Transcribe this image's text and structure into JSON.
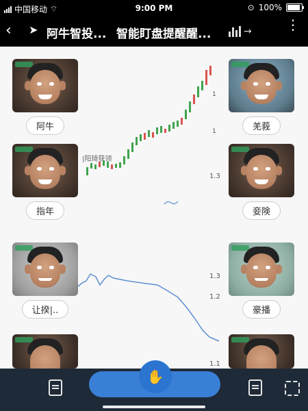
{
  "status_bar": {
    "carrier": "中国移动",
    "time": "9:00 PM",
    "battery": "100%"
  },
  "header": {
    "back_icon": "chevron-left-icon",
    "nav_icon": "navigation-arrow-icon",
    "title": "阿牛智投...",
    "subtitle": "智能盯盘提醒醒...",
    "chart_icon": "bar-chart-arrow-icon",
    "more_icon": "more-vertical-icon"
  },
  "avatars": [
    {
      "label": "阿牛",
      "side": "left"
    },
    {
      "label": "羌莪",
      "side": "right"
    },
    {
      "label": "指年",
      "side": "left"
    },
    {
      "label": "妾険",
      "side": "right"
    },
    {
      "label": "让揆|..",
      "side": "left"
    },
    {
      "label": "豪播",
      "side": "right"
    },
    {
      "label": "",
      "side": "left"
    },
    {
      "label": "",
      "side": "right"
    }
  ],
  "chart_labels": {
    "value_top": "1",
    "value_mid": "1",
    "tag": "|阳琦获领",
    "y13_a": "1.3",
    "y13_b": "1.3",
    "y12": "1.2",
    "y11": "1.1"
  },
  "toolbar": {
    "left_icon": "document-refresh-icon",
    "center_icon": "hand-pointer-icon",
    "right_icon": "document-list-icon",
    "far_right_icon": "scan-icon"
  },
  "chart_data": {
    "type": "line",
    "title": "",
    "series": [
      {
        "values": [
          1.22,
          1.23,
          1.22,
          1.24,
          1.23,
          1.24,
          1.25,
          1.27,
          1.29,
          1.3,
          1.31,
          1.33,
          1.35,
          1.36,
          1.38,
          1.4
        ]
      }
    ],
    "xlabel": "",
    "ylabel": "",
    "ylim": [
      1.1,
      1.4
    ]
  }
}
